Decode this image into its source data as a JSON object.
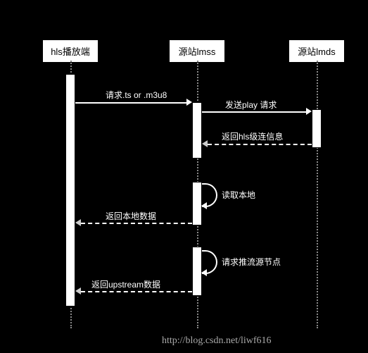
{
  "participants": {
    "p1": "hls播放端",
    "p2": "源站lmss",
    "p3": "源站lmds"
  },
  "messages": {
    "m1": "请求.ts or .m3u8",
    "m2": "发送play 请求",
    "m3": "返回hls级连信息",
    "m4": "读取本地",
    "m5": "返回本地数据",
    "m6": "请求推流源节点",
    "m7": "返回upstream数据"
  },
  "watermark": "http://blog.csdn.net/liwf616"
}
